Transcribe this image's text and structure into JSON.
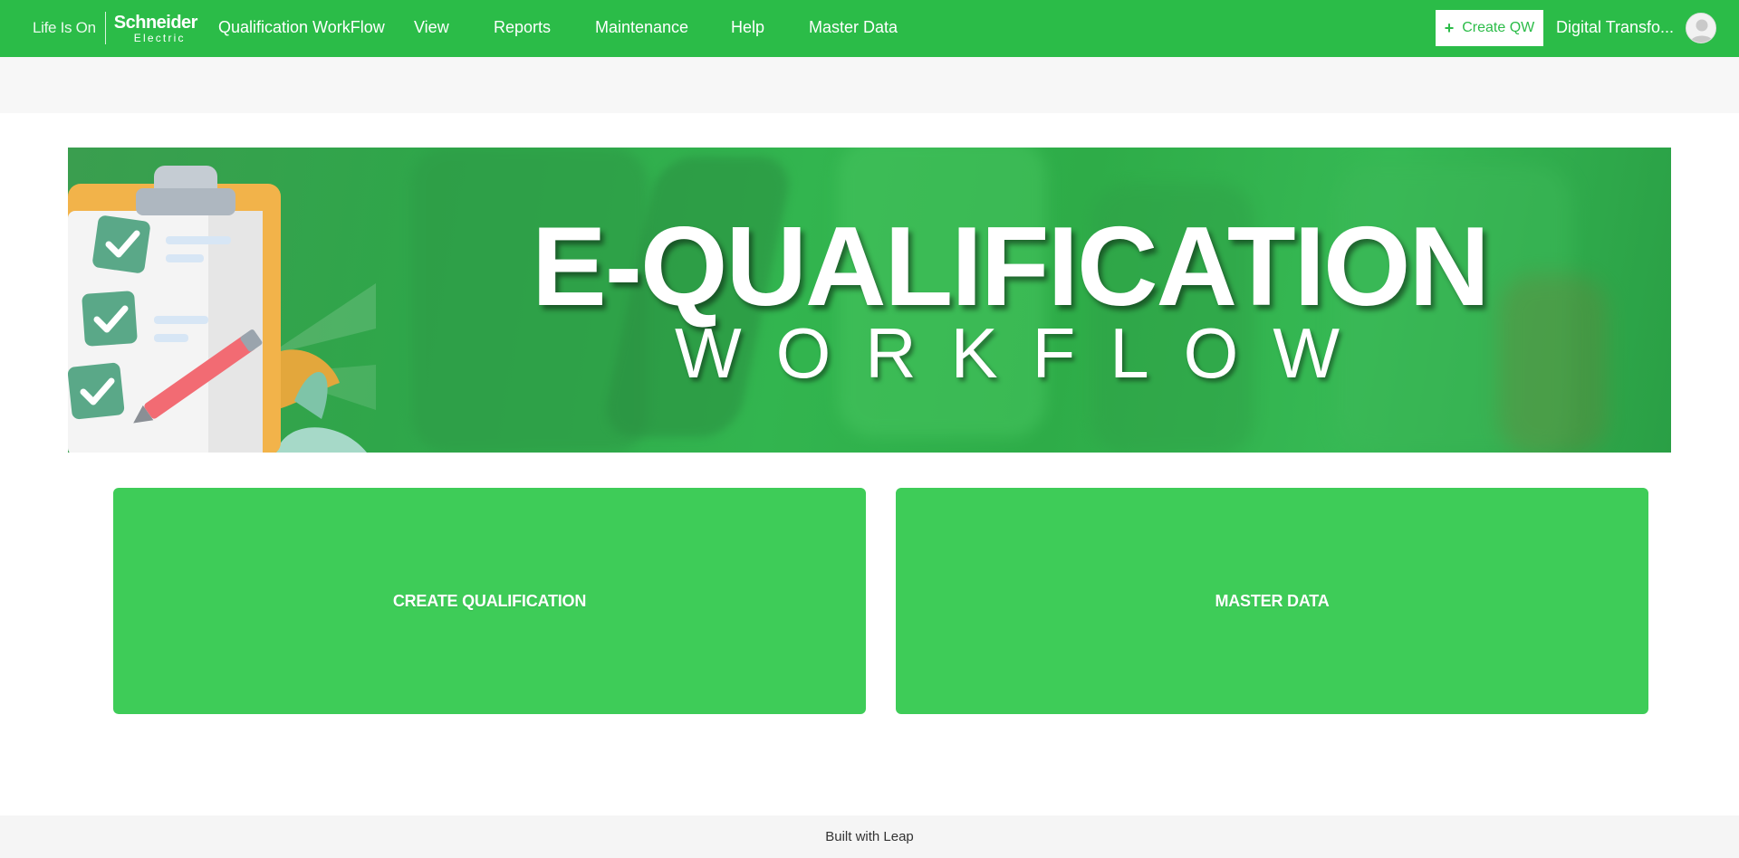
{
  "brand": {
    "tagline": "Life Is On",
    "company": "Schneider",
    "company_sub": "Electric"
  },
  "nav": {
    "items": [
      {
        "label": "Qualification WorkFlow"
      },
      {
        "label": "View"
      },
      {
        "label": "Reports"
      },
      {
        "label": "Maintenance"
      },
      {
        "label": "Help"
      },
      {
        "label": "Master Data"
      }
    ],
    "create_button": "Create QW",
    "user_name": "Digital Transfo..."
  },
  "banner": {
    "title": "E-QUALIFICATION",
    "subtitle": "WORKFLOW"
  },
  "cards": [
    {
      "label": "CREATE QUALIFICATION"
    },
    {
      "label": "MASTER DATA"
    }
  ],
  "footer": {
    "text": "Built with Leap"
  },
  "colors": {
    "primary_green": "#2bbc48",
    "card_green": "#3ecc58"
  },
  "icons": {
    "create_button": "plus-icon",
    "user": "user-avatar-icon",
    "banner_art": "clipboard-checklist-icon"
  }
}
